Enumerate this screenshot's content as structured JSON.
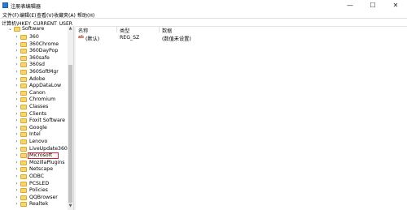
{
  "window": {
    "title": "注册表编辑器",
    "controls": {
      "minimize": "—",
      "maximize": "☐",
      "close": "✕"
    }
  },
  "menu": {
    "items": [
      "文件(F)",
      "编辑(E)",
      "查看(V)",
      "收藏夹(A)",
      "帮助(H)"
    ]
  },
  "address": {
    "path": "计算机\\HKEY_CURRENT_USER"
  },
  "tree": {
    "root": "Software",
    "items": [
      {
        "label": "360"
      },
      {
        "label": "360Chrome"
      },
      {
        "label": "360DayPop"
      },
      {
        "label": "360safe"
      },
      {
        "label": "360sd"
      },
      {
        "label": "360SoftMgr"
      },
      {
        "label": "Adobe"
      },
      {
        "label": "AppDataLow"
      },
      {
        "label": "Canon"
      },
      {
        "label": "Chromium"
      },
      {
        "label": "Classes"
      },
      {
        "label": "Clients"
      },
      {
        "label": "Foxit Software"
      },
      {
        "label": "Google"
      },
      {
        "label": "Intel"
      },
      {
        "label": "Lenovo"
      },
      {
        "label": "LiveUpdate360"
      },
      {
        "label": "Microsoft",
        "selected": true
      },
      {
        "label": "MozillaPlugins"
      },
      {
        "label": "Netscape"
      },
      {
        "label": "ODBC"
      },
      {
        "label": "PCSLED"
      },
      {
        "label": "Policies"
      },
      {
        "label": "QQBrowser"
      },
      {
        "label": "Realtek"
      }
    ]
  },
  "values": {
    "columns": [
      "名称",
      "类型",
      "数据"
    ],
    "rows": [
      {
        "icon": "ab",
        "name": "(默认)",
        "type": "REG_SZ",
        "data": "(数值未设置)"
      }
    ]
  }
}
